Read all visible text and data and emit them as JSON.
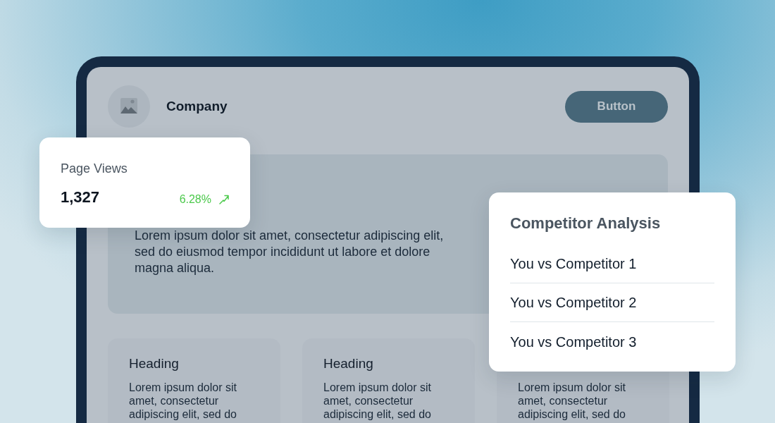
{
  "header": {
    "company": "Company",
    "button": "Button"
  },
  "hero": {
    "text": "Lorem ipsum dolor sit amet, consectetur adipiscing elit, sed do eiusmod tempor incididunt ut labore et dolore magna aliqua."
  },
  "cards": [
    {
      "heading": "Heading",
      "text": "Lorem ipsum dolor sit amet, consectetur adipiscing elit, sed do"
    },
    {
      "heading": "Heading",
      "text": "Lorem ipsum dolor sit amet, consectetur adipiscing elit, sed do"
    },
    {
      "text": "Lorem ipsum dolor sit amet, consectetur adipiscing elit, sed do"
    }
  ],
  "stat_card": {
    "label": "Page Views",
    "value": "1,327",
    "change": "6.28%",
    "positive": true
  },
  "competitor_card": {
    "title": "Competitor Analysis",
    "items": [
      "You vs Competitor 1",
      "You vs Competitor 2",
      "You vs Competitor 3"
    ]
  }
}
